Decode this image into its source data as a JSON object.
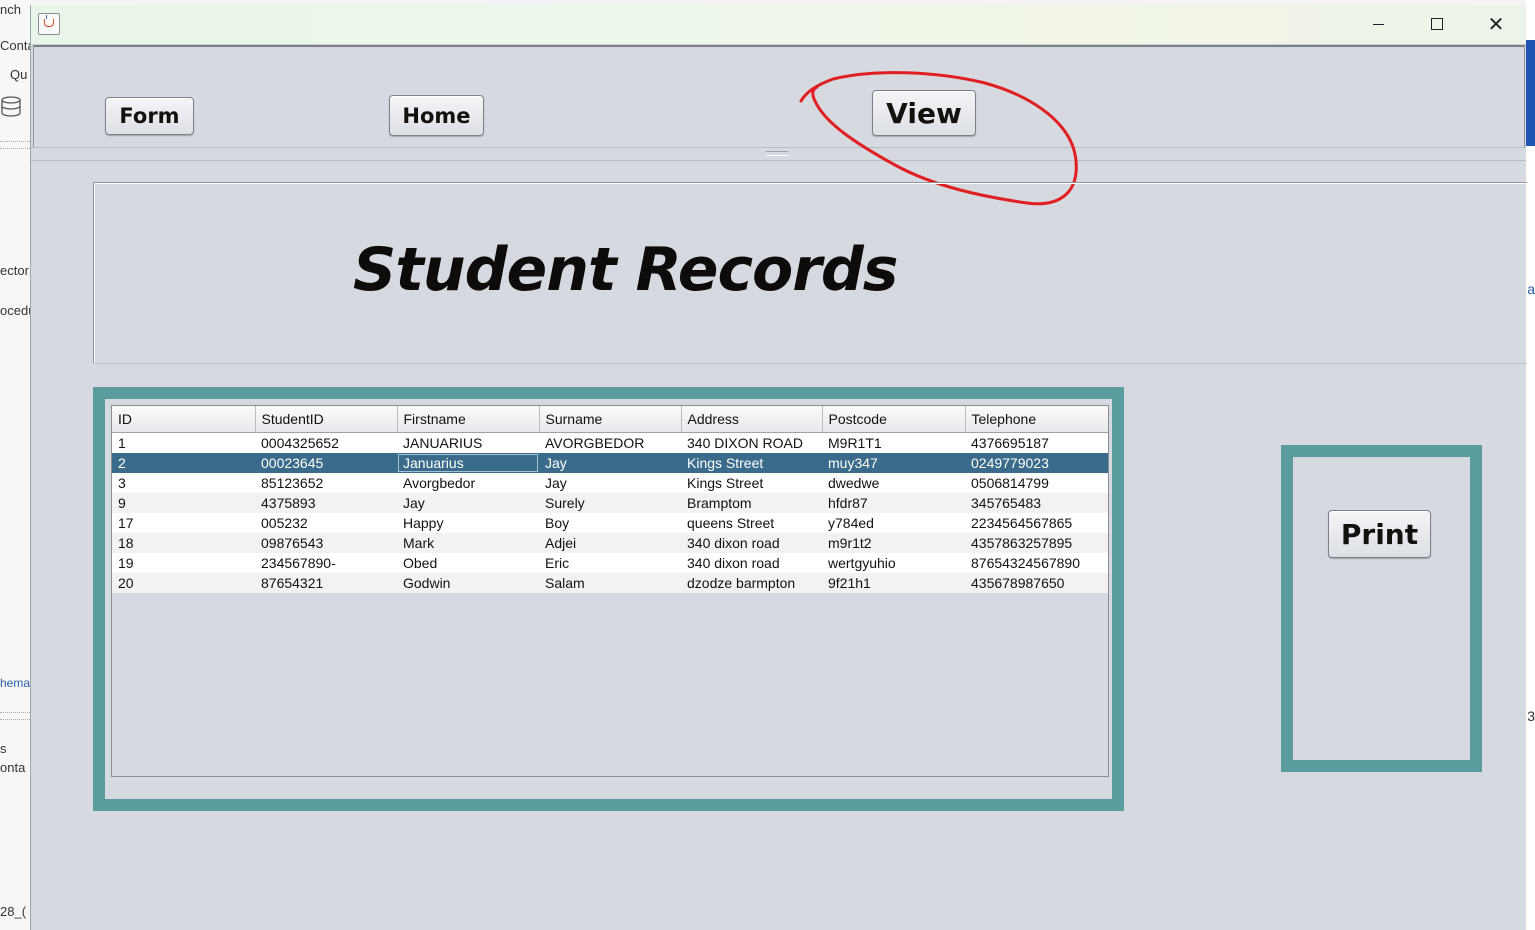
{
  "background": {
    "left_fragments": [
      "nch",
      "Conta",
      "Qu",
      "ector",
      "ocedu",
      "hema",
      "s",
      "onta",
      "28_("
    ],
    "right_fragments": [
      "a",
      "3"
    ]
  },
  "window": {
    "title": "",
    "controls": {
      "minimize_icon": "minimize-icon",
      "maximize_icon": "maximize-icon",
      "close_icon": "close-icon",
      "close_glyph": "✕"
    }
  },
  "nav": {
    "form_label": "Form",
    "home_label": "Home",
    "view_label": "View",
    "annotation_color": "#e02020"
  },
  "header": {
    "title": "Student Records"
  },
  "table": {
    "columns": [
      "ID",
      "StudentID",
      "Firstname",
      "Surname",
      "Address",
      "Postcode",
      "Telephone"
    ],
    "selected_row": 1,
    "rows": [
      [
        "1",
        "0004325652",
        "JANUARIUS",
        "AVORGBEDOR",
        "340 DIXON ROAD",
        "M9R1T1",
        "4376695187"
      ],
      [
        "2",
        "00023645",
        "Januarius",
        "Jay",
        "Kings Street",
        "muy347",
        "0249779023"
      ],
      [
        "3",
        "85123652",
        "Avorgbedor",
        "Jay",
        "Kings Street",
        "dwedwe",
        "0506814799"
      ],
      [
        "9",
        "4375893",
        "Jay",
        "Surely",
        "Bramptom",
        "hfdr87",
        "345765483"
      ],
      [
        "17",
        "005232",
        "Happy",
        "Boy",
        "queens Street",
        "y784ed",
        "2234564567865"
      ],
      [
        "18",
        "09876543",
        "Mark",
        "Adjei",
        "340 dixon road",
        "m9r1t2",
        "4357863257895"
      ],
      [
        "19",
        "234567890-",
        "Obed",
        "Eric",
        "340 dixon road",
        "wertgyuhio",
        "87654324567890"
      ],
      [
        "20",
        "87654321",
        "Godwin",
        "Salam",
        "dzodze barmpton",
        "9f21h1",
        "435678987650"
      ]
    ]
  },
  "actions": {
    "print_label": "Print"
  },
  "colors": {
    "accent_border": "#5b9c9d",
    "selection": "#3a6b8b",
    "window_bg": "#d6d9e0"
  }
}
